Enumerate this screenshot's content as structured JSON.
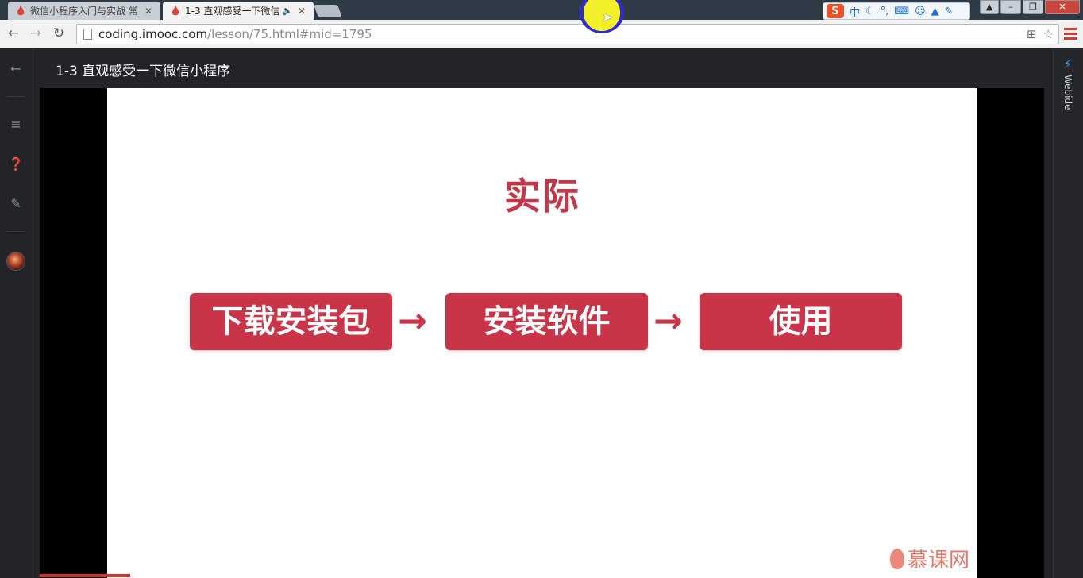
{
  "browser": {
    "tabs": [
      {
        "title": "微信小程序入门与实战 常",
        "active": false
      },
      {
        "title": "1-3 直观感受一下微信",
        "active": true
      }
    ],
    "url": {
      "host": "coding.imooc.com",
      "path": "/lesson/75.html#mid=1795"
    },
    "ime": {
      "lang": "中"
    }
  },
  "page": {
    "lesson_title": "1-3 直观感受一下微信小程序",
    "right_panel_label": "Webide"
  },
  "slide": {
    "title": "实际",
    "steps": [
      "下载安装包",
      "安装软件",
      "使用"
    ],
    "arrow_glyph": "→",
    "brand": "慕课网"
  },
  "video": {
    "progress_fraction": 0.09
  },
  "colors": {
    "accent": "#c93448",
    "chrome_bg": "#2f3a47",
    "page_bg": "#222427"
  }
}
